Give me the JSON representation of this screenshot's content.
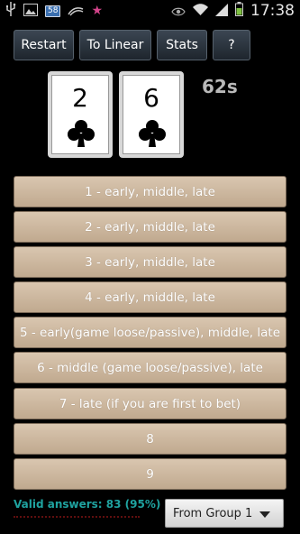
{
  "status_bar": {
    "time": "17:38",
    "notification_badge": "58",
    "icons": [
      "usb-icon",
      "image-icon",
      "badge-58-icon",
      "swirl-icon",
      "star-icon",
      "eye-icon",
      "wifi-icon",
      "signal-icon",
      "battery-icon"
    ]
  },
  "toolbar": {
    "restart_label": "Restart",
    "linear_label": "To Linear",
    "stats_label": "Stats",
    "help_label": "?"
  },
  "cards": [
    {
      "rank": "2",
      "suit": "clubs"
    },
    {
      "rank": "6",
      "suit": "clubs"
    }
  ],
  "timer": "62s",
  "answers": [
    "1 - early, middle, late",
    "2 - early, middle, late",
    "3 - early, middle, late",
    "4 - early, middle, late",
    "5 - early(game loose/passive), middle, late",
    "6 - middle (game loose/passive), late",
    "7 - late (if you are first to bet)",
    "8",
    "9"
  ],
  "footer": {
    "valid_answers": "Valid answers: 83 (95%)",
    "group_select": "From Group 1"
  },
  "colors": {
    "answer_button": "#cdb9a1",
    "toolbar_button": "#2c353f",
    "valid_text": "#1fa3a0"
  }
}
